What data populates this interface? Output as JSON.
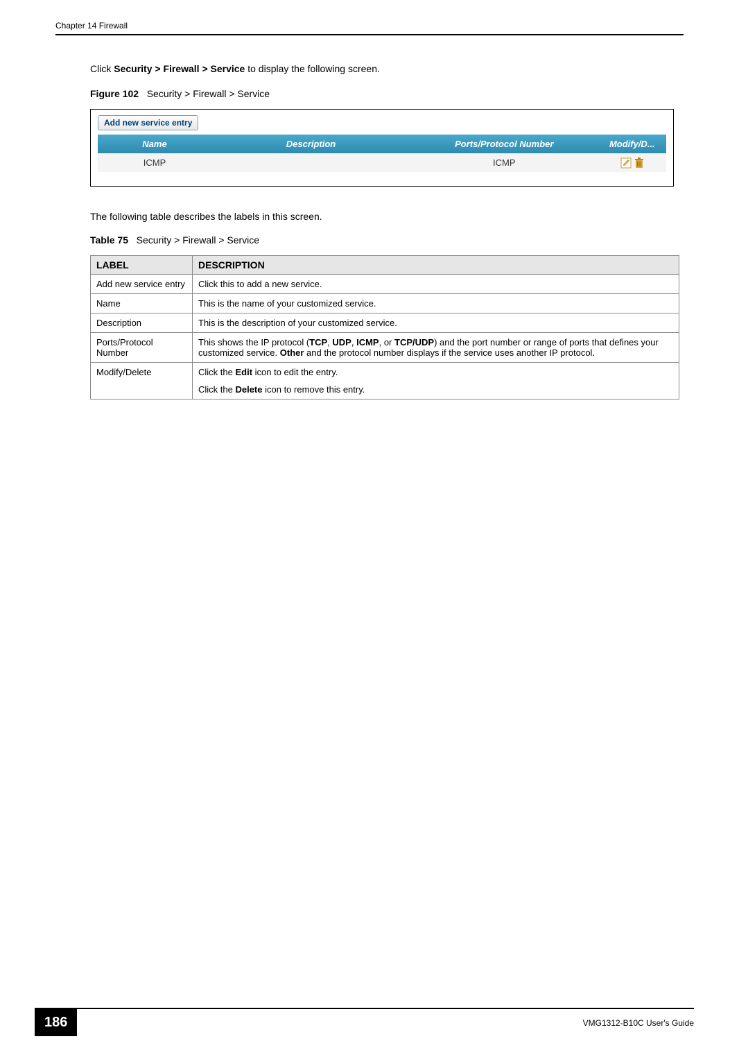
{
  "header": {
    "chapter": "Chapter 14 Firewall"
  },
  "intro": {
    "prefix": "Click ",
    "path": "Security > Firewall > Service",
    "suffix": " to display the following screen."
  },
  "figure": {
    "label": "Figure 102",
    "caption": "Security > Firewall > Service"
  },
  "screenshot": {
    "add_button": "Add new service entry",
    "headers": {
      "name": "Name",
      "description": "Description",
      "ports": "Ports/Protocol Number",
      "modify": "Modify/D..."
    },
    "row": {
      "name": "ICMP",
      "description": "",
      "ports": "ICMP"
    }
  },
  "below_figure": "The following table describes the labels in this screen.",
  "table_caption": {
    "label": "Table 75",
    "caption": "Security > Firewall > Service"
  },
  "desc_table": {
    "header_label": "LABEL",
    "header_desc": "DESCRIPTION",
    "rows": [
      {
        "label": "Add new service entry",
        "desc": "Click this to add a new service."
      },
      {
        "label": "Name",
        "desc": "This is the name of your customized service."
      },
      {
        "label": "Description",
        "desc": "This is the description of your customized service."
      },
      {
        "label": "Ports/Protocol Number",
        "desc_pre": "This shows the IP protocol (",
        "b1": "TCP",
        "c1": ", ",
        "b2": "UDP",
        "c2": ", ",
        "b3": "ICMP",
        "c3": ", or ",
        "b4": "TCP/UDP",
        "c4": ") and the port number or range of ports that defines your customized service. ",
        "b5": "Other",
        "c5": " and the protocol number displays if the service uses another IP protocol."
      },
      {
        "label": "Modify/Delete",
        "p1_pre": "Click the ",
        "p1_b": "Edit",
        "p1_post": " icon to edit the entry.",
        "p2_pre": "Click the ",
        "p2_b": "Delete",
        "p2_post": " icon to remove this entry."
      }
    ]
  },
  "footer": {
    "page_number": "186",
    "guide": "VMG1312-B10C User's Guide"
  }
}
